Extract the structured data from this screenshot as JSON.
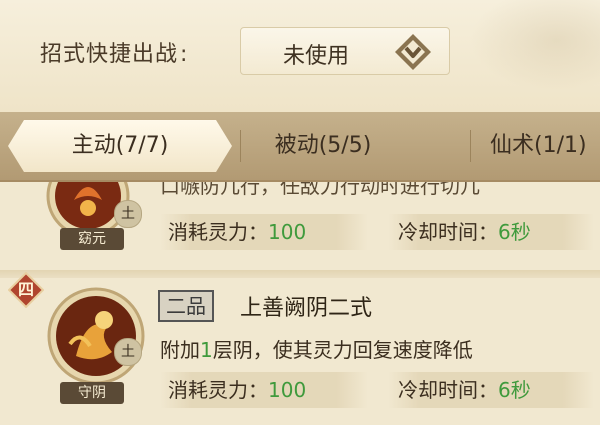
{
  "shortcut": {
    "label": "招式快捷出战",
    "colon": ":",
    "value": "未使用"
  },
  "tabs": [
    {
      "label": "主动(7/7)",
      "active": true
    },
    {
      "label": "被动(5/5)",
      "active": false
    },
    {
      "label": "仙术(1/1)",
      "active": false
    }
  ],
  "skills": [
    {
      "icon_name": "窈元",
      "element": "土",
      "cut_description": "口嗾防几行，任敌刀行动时进行切几",
      "cost_label": "消耗灵力：",
      "cost_value": "100",
      "cooldown_label": "冷却时间：",
      "cooldown_value": "6秒"
    },
    {
      "rank": "四",
      "grade": "二品",
      "title": "上善阙阴二式",
      "icon_name": "守阴",
      "element": "土",
      "desc_prefix": "附加",
      "desc_num": "1",
      "desc_suffix": "层阴，使其灵力回复速度降低",
      "cost_label": "消耗灵力：",
      "cost_value": "100",
      "cooldown_label": "冷却时间：",
      "cooldown_value": "6秒"
    }
  ],
  "colors": {
    "accent_green": "#3f9a3c",
    "rank_red": "#b0452e",
    "icon_gold": "#e8a23a"
  }
}
